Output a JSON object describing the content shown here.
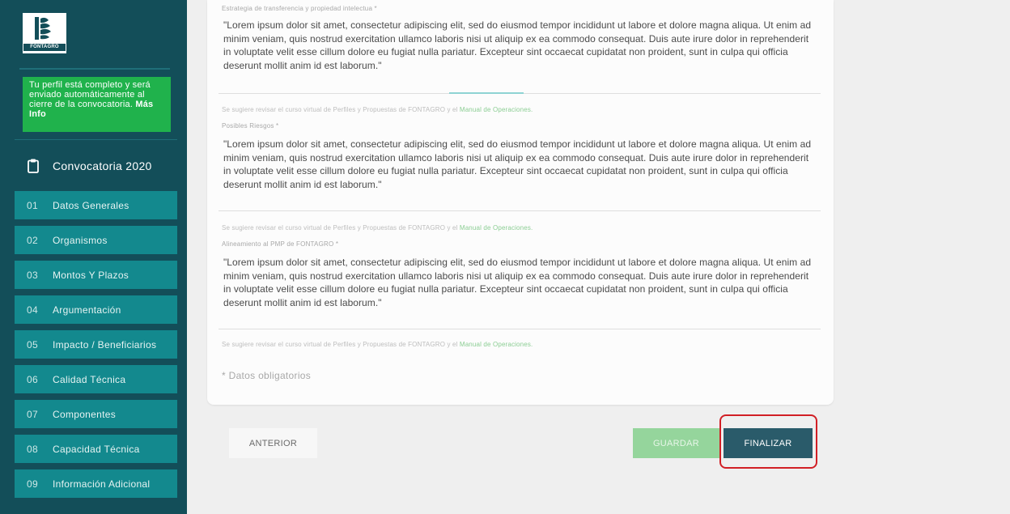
{
  "sidebar": {
    "logo_text": "FONTAGRO",
    "profile_note": {
      "text": "Tu perfil está completo y será enviado automáticamente al cierre de la convocatoria. ",
      "link": "Más Info"
    },
    "call_label": "Convocatoria 2020",
    "items": [
      {
        "num": "01",
        "label": "Datos Generales"
      },
      {
        "num": "02",
        "label": "Organismos"
      },
      {
        "num": "03",
        "label": "Montos Y Plazos"
      },
      {
        "num": "04",
        "label": "Argumentación"
      },
      {
        "num": "05",
        "label": "Impacto / Beneficiarios"
      },
      {
        "num": "06",
        "label": "Calidad Técnica"
      },
      {
        "num": "07",
        "label": "Componentes"
      },
      {
        "num": "08",
        "label": "Capacidad Técnica"
      },
      {
        "num": "09",
        "label": "Información Adicional"
      }
    ]
  },
  "form": {
    "fields": [
      {
        "label": "Estrategia de transferencia y propiedad intelectua *",
        "value": "\"Lorem ipsum dolor sit amet, consectetur adipiscing elit, sed do eiusmod tempor incididunt ut labore et dolore magna aliqua. Ut enim ad minim veniam, quis nostrud exercitation ullamco laboris nisi ut aliquip ex ea commodo consequat. Duis aute irure dolor in reprehenderit in voluptate velit esse cillum dolore eu fugiat nulla pariatur. Excepteur sint occaecat cupidatat non proident, sunt in culpa qui officia deserunt mollit anim id est laborum.\""
      },
      {
        "label": "Posibles Riesgos *",
        "value": "\"Lorem ipsum dolor sit amet, consectetur adipiscing elit, sed do eiusmod tempor incididunt ut labore et dolore magna aliqua. Ut enim ad minim veniam, quis nostrud exercitation ullamco laboris nisi ut aliquip ex ea commodo consequat. Duis aute irure dolor in reprehenderit in voluptate velit esse cillum dolore eu fugiat nulla pariatur. Excepteur sint occaecat cupidatat non proident, sunt in culpa qui officia deserunt mollit anim id est laborum.\""
      },
      {
        "label": "Alineamiento al PMP de FONTAGRO *",
        "value": "\"Lorem ipsum dolor sit amet, consectetur adipiscing elit, sed do eiusmod tempor incididunt ut labore et dolore magna aliqua. Ut enim ad minim veniam, quis nostrud exercitation ullamco laboris nisi ut aliquip ex ea commodo consequat. Duis aute irure dolor in reprehenderit in voluptate velit esse cillum dolore eu fugiat nulla pariatur. Excepteur sint occaecat cupidatat non proident, sunt in culpa qui officia deserunt mollit anim id est laborum.\""
      }
    ],
    "hint_text": "Se sugiere revisar el curso virtual de Perfiles y Propuestas de FONTAGRO y el ",
    "hint_link": "Manual de Operaciones.",
    "required_note": "* Datos obligatorios"
  },
  "buttons": {
    "previous": "ANTERIOR",
    "save": "GUARDAR",
    "finish": "FINALIZAR"
  },
  "colors": {
    "sidebar": "#134e59",
    "nav_item": "#13898e",
    "profile_note": "#20b24c",
    "save_button": "#95d59c",
    "finish_button": "#2a5b6a",
    "highlight": "#d11f25"
  }
}
